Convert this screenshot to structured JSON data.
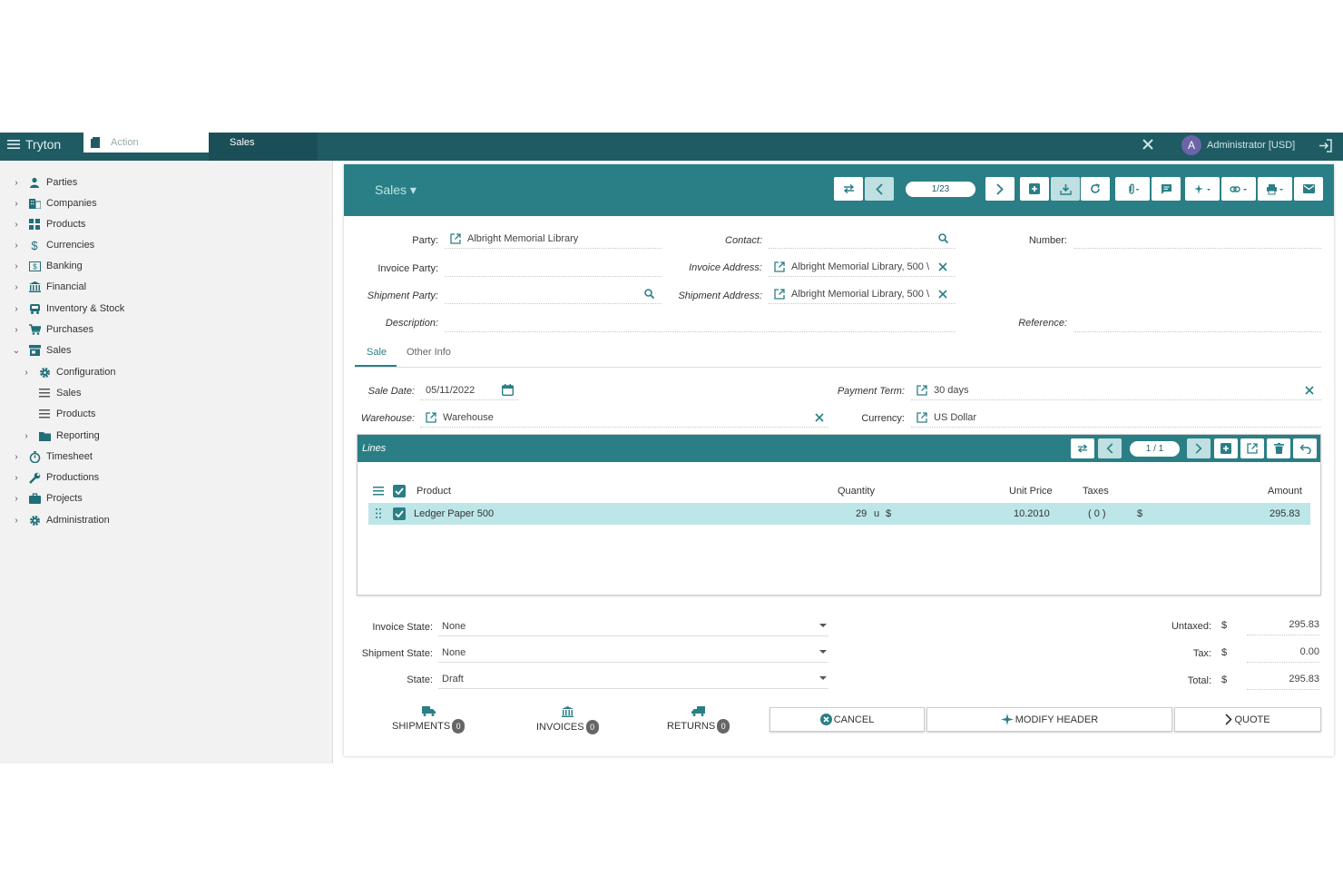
{
  "topbar": {
    "brand": "Tryton",
    "action_placeholder": "Action",
    "active_tab": "Sales",
    "user": "Administrator [USD]",
    "avatar_letter": "A"
  },
  "sidebar": {
    "items": [
      {
        "label": "Parties",
        "icon": "user-icon"
      },
      {
        "label": "Companies",
        "icon": "building-icon"
      },
      {
        "label": "Products",
        "icon": "products-icon"
      },
      {
        "label": "Currencies",
        "icon": "dollar-icon"
      },
      {
        "label": "Banking",
        "icon": "bank-card-icon"
      },
      {
        "label": "Financial",
        "icon": "bank-icon"
      },
      {
        "label": "Inventory & Stock",
        "icon": "truck-icon"
      },
      {
        "label": "Purchases",
        "icon": "cart-icon"
      },
      {
        "label": "Sales",
        "icon": "shop-icon"
      },
      {
        "label": "Configuration",
        "icon": "gear-icon"
      },
      {
        "label": "Sales",
        "icon": "list-icon"
      },
      {
        "label": "Products",
        "icon": "list-icon"
      },
      {
        "label": "Reporting",
        "icon": "folder-icon"
      },
      {
        "label": "Timesheet",
        "icon": "timer-icon"
      },
      {
        "label": "Productions",
        "icon": "wrench-icon"
      },
      {
        "label": "Projects",
        "icon": "briefcase-icon"
      },
      {
        "label": "Administration",
        "icon": "gear-icon"
      }
    ]
  },
  "form": {
    "title": "Sales",
    "record_pager": "1/23",
    "labels": {
      "party": "Party:",
      "invoice_party": "Invoice Party:",
      "shipment_party": "Shipment Party:",
      "description": "Description:",
      "contact": "Contact:",
      "invoice_address": "Invoice Address:",
      "shipment_address": "Shipment Address:",
      "number": "Number:",
      "reference": "Reference:",
      "sale_date": "Sale Date:",
      "warehouse": "Warehouse:",
      "payment_term": "Payment Term:",
      "currency": "Currency:"
    },
    "values": {
      "party": "Albright Memorial Library",
      "invoice_party": "",
      "shipment_party": "",
      "description": "",
      "contact": "",
      "invoice_address": "Albright Memorial Library, 500 \\",
      "shipment_address": "Albright Memorial Library, 500 \\",
      "number": "",
      "reference": "",
      "sale_date": "05/11/2022",
      "warehouse": "Warehouse",
      "payment_term": "30 days",
      "currency": "US Dollar"
    },
    "tabs": [
      "Sale",
      "Other Info"
    ]
  },
  "lines": {
    "title": "Lines",
    "pager": "1 / 1",
    "columns": {
      "product": "Product",
      "quantity": "Quantity",
      "unit_price": "Unit Price",
      "taxes": "Taxes",
      "amount": "Amount"
    },
    "rows": [
      {
        "product": "Ledger Paper 500",
        "quantity": "29",
        "unit": "u",
        "currency": "$",
        "unit_price": "10.2010",
        "taxes": "( 0 )",
        "amount_currency": "$",
        "amount": "295.83"
      }
    ]
  },
  "states": {
    "invoice_state_label": "Invoice State:",
    "invoice_state": "None",
    "shipment_state_label": "Shipment State:",
    "shipment_state": "None",
    "state_label": "State:",
    "state": "Draft"
  },
  "totals": {
    "untaxed_label": "Untaxed:",
    "untaxed": "295.83",
    "tax_label": "Tax:",
    "tax": "0.00",
    "total_label": "Total:",
    "total": "295.83",
    "currency": "$"
  },
  "relations": [
    {
      "label": "SHIPMENTS",
      "count": "0"
    },
    {
      "label": "INVOICES",
      "count": "0"
    },
    {
      "label": "RETURNS",
      "count": "0"
    }
  ],
  "buttons": {
    "cancel": "CANCEL",
    "modify_header": "MODIFY HEADER",
    "quote": "QUOTE"
  }
}
